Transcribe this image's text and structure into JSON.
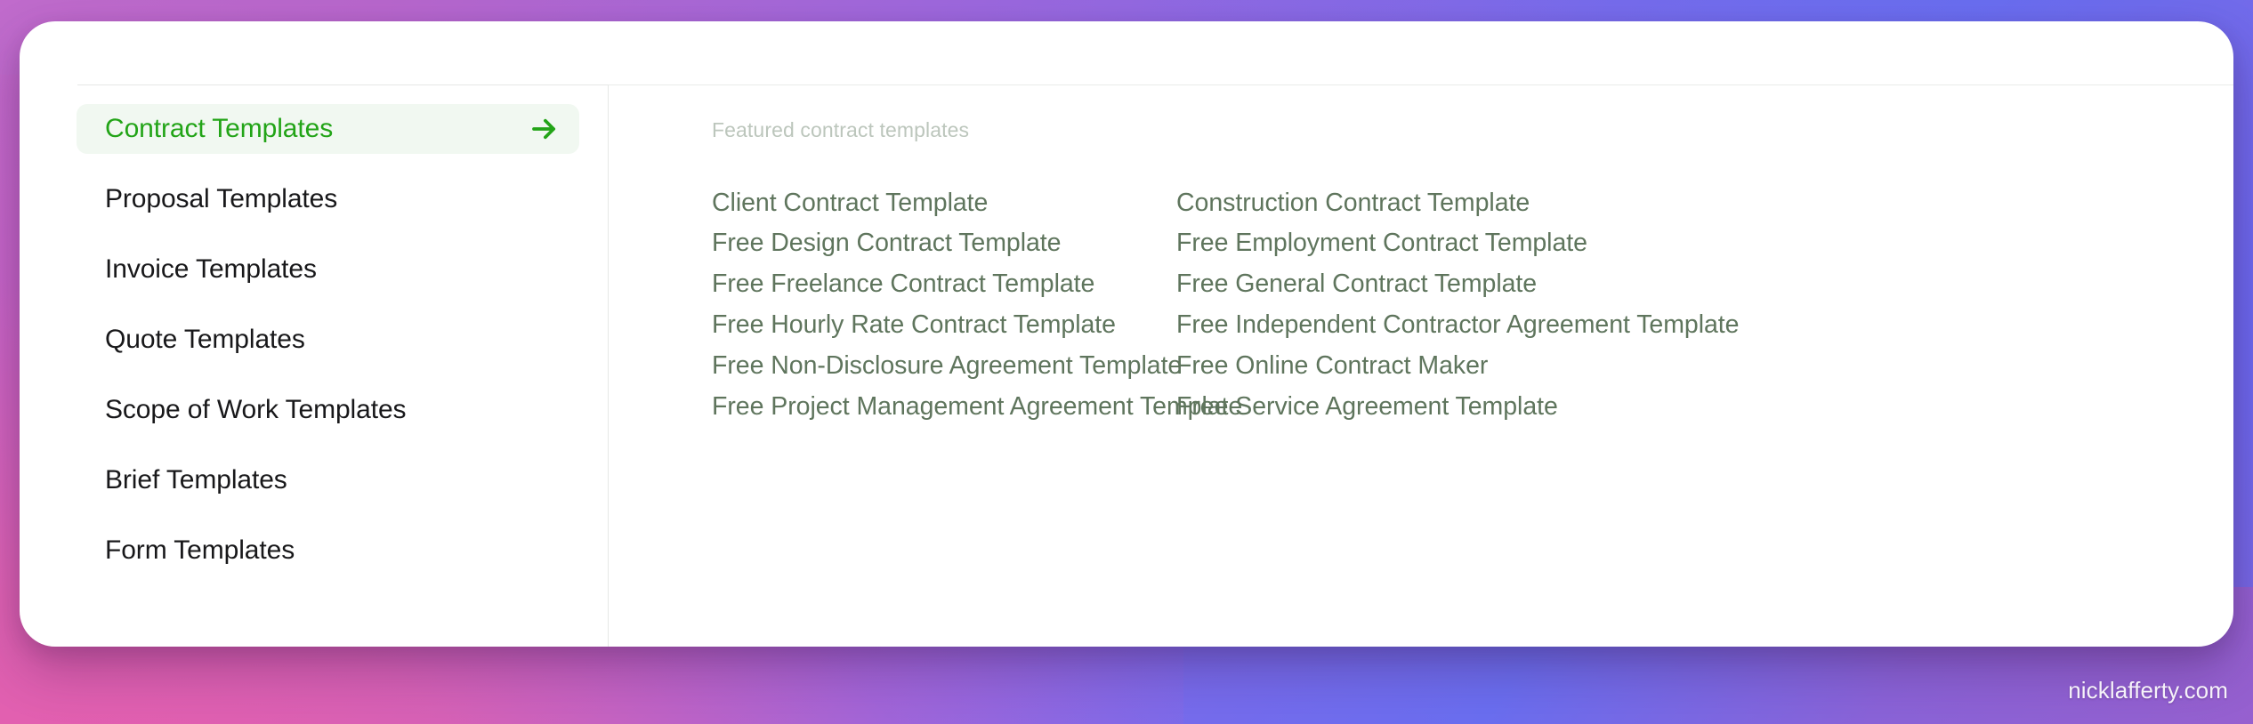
{
  "watermark": "nicklafferty.com",
  "theme": {
    "accent_green": "#22a417",
    "active_pill_bg": "#f1f8f1",
    "link_green": "#5f755d",
    "heading_gray": "#bcc6bc",
    "card_bg": "#ffffff",
    "bg_top_left": "#bf6bca",
    "bg_top_right": "#6a6ef0",
    "bg_bottom_left": "#ec5fa8",
    "bg_bottom_right": "#9660cf"
  },
  "sidebar": {
    "items": [
      {
        "label": "Contract Templates",
        "active": true,
        "arrow_icon": "arrow-right-icon"
      },
      {
        "label": "Proposal Templates",
        "active": false
      },
      {
        "label": "Invoice Templates",
        "active": false
      },
      {
        "label": "Quote Templates",
        "active": false
      },
      {
        "label": "Scope of Work Templates",
        "active": false
      },
      {
        "label": "Brief Templates",
        "active": false
      },
      {
        "label": "Form Templates",
        "active": false
      }
    ]
  },
  "content": {
    "heading": "Featured contract templates",
    "columns": [
      {
        "links": [
          "Client Contract Template",
          "Free Design Contract Template",
          "Free Freelance Contract Template",
          "Free Hourly Rate Contract Template",
          "Free Non-Disclosure Agreement Template",
          "Free Project Management Agreement Template"
        ]
      },
      {
        "links": [
          "Construction Contract Template",
          "Free Employment Contract Template",
          "Free General Contract Template",
          "Free Independent Contractor Agreement Template",
          "Free Online Contract Maker",
          "Free Service Agreement Template"
        ]
      }
    ]
  }
}
